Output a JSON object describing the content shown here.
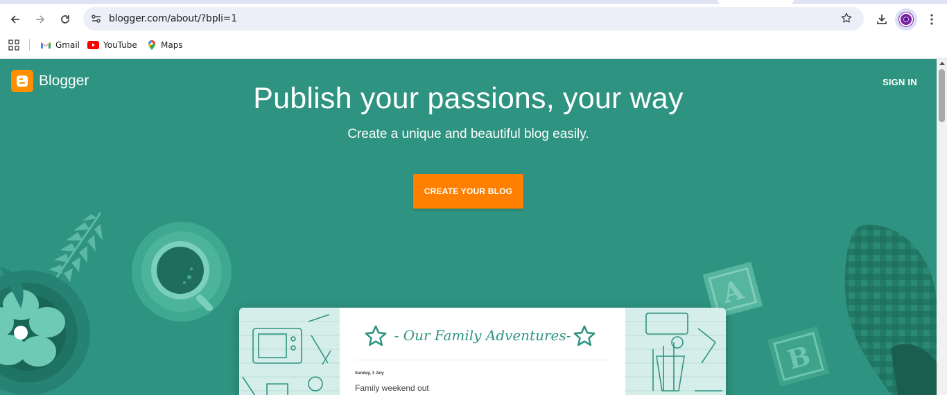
{
  "browser": {
    "url": "blogger.com/about/?bpli=1",
    "bookmarks": [
      {
        "label": "Gmail",
        "icon": "gmail-icon"
      },
      {
        "label": "YouTube",
        "icon": "youtube-icon"
      },
      {
        "label": "Maps",
        "icon": "maps-icon"
      }
    ]
  },
  "page": {
    "brand": "Blogger",
    "sign_in": "SIGN IN",
    "headline": "Publish your passions, your way",
    "subheadline": "Create a unique and beautiful blog easily.",
    "cta": "CREATE YOUR BLOG",
    "blog_preview": {
      "title": "- Our Family Adventures-",
      "date": "Sunday, 3 July",
      "post_title": "Family weekend out"
    }
  },
  "colors": {
    "page_background": "#2e9380",
    "cta": "#ff7f00",
    "brand_logo": "#ff8f00"
  }
}
